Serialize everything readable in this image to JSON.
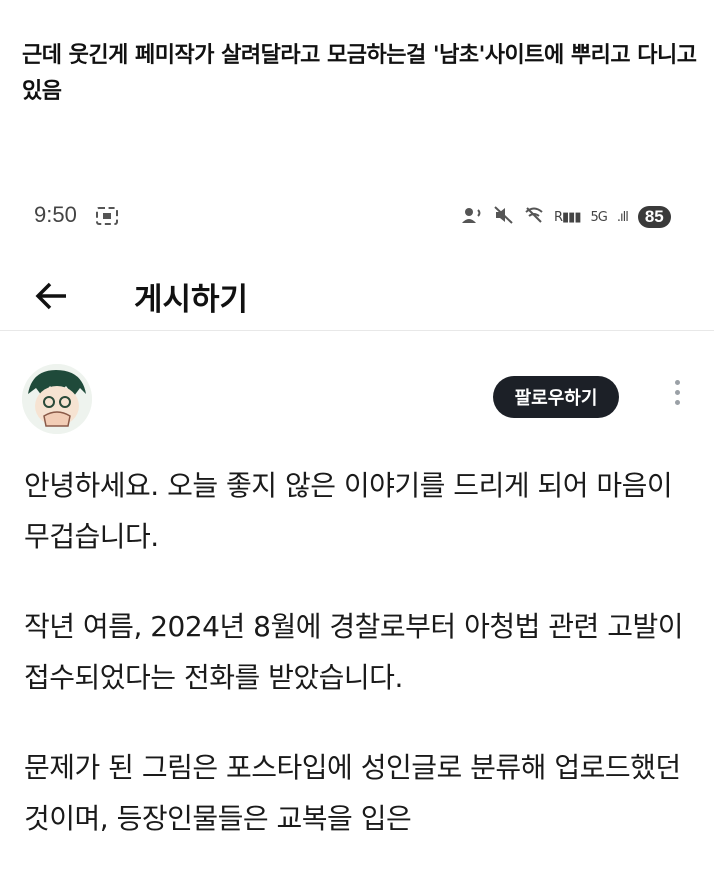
{
  "caption": {
    "text": "근데 웃긴게 페미작가 살려달라고 모금하는걸 '남초'사이트에 뿌리고 다니고 있음"
  },
  "status_bar": {
    "time": "9:50",
    "battery": "85",
    "network": "5G"
  },
  "app_bar": {
    "title": "게시하기"
  },
  "post": {
    "follow_label": "팔로우하기",
    "paragraphs": [
      "안녕하세요. 오늘 좋지 않은 이야기를 드리게 되어 마음이 무겁습니다.",
      "작년 여름, 2024년 8월에 경찰로부터 아청법 관련 고발이 접수되었다는 전화를 받았습니다.",
      "문제가 된 그림은 포스타입에 성인글로 분류해 업로드했던 것이며, 등장인물들은 교복을 입은"
    ]
  }
}
